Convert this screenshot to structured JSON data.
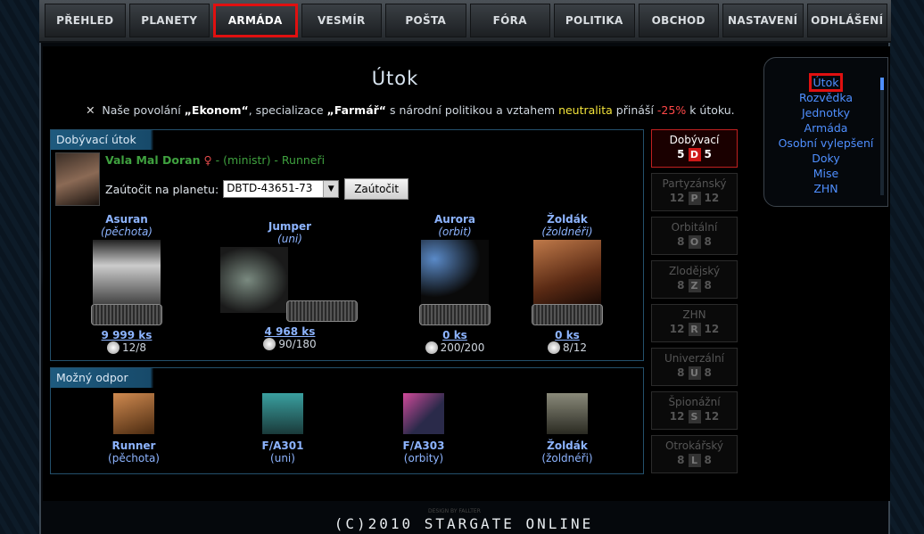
{
  "nav": [
    {
      "label": "PŘEHLED"
    },
    {
      "label": "PLANETY"
    },
    {
      "label": "ARMÁDA",
      "active": true
    },
    {
      "label": "VESMÍR"
    },
    {
      "label": "POŠTA"
    },
    {
      "label": "FÓRA"
    },
    {
      "label": "POLITIKA"
    },
    {
      "label": "OBCHOD"
    },
    {
      "label": "NASTAVENÍ"
    },
    {
      "label": "ODHLÁŠENÍ"
    }
  ],
  "page_title": "Útok",
  "info": {
    "prefix": "Naše povolání",
    "profession": "„Ekonom“",
    "mid1": ", specializace",
    "specialization": "„Farmář“",
    "mid2": "s národní politikou a vztahem",
    "relation": "neutralita",
    "mid3": "přináší",
    "bonus": "-25%",
    "suffix": "k útoku."
  },
  "attack_panel": {
    "title": "Dobývací útok",
    "player_name": "Vala Mal Doran",
    "gender_symbol": "♀",
    "player_meta": "- (ministr) - Runneři",
    "attack_label": "Zaútočit na planetu:",
    "planet_value": "DBTD-43651-73",
    "attack_button": "Zaútočit"
  },
  "units": [
    {
      "name": "Asuran",
      "type": "(pěchota)",
      "count": "9 999 ks",
      "stat": "12/8"
    },
    {
      "name": "Jumper",
      "type": "(uni)",
      "count": "4 968 ks",
      "stat": "90/180"
    },
    {
      "name": "Aurora",
      "type": "(orbit)",
      "count": "0 ks",
      "stat": "200/200"
    },
    {
      "name": "Žoldák",
      "type": "(žoldnéři)",
      "count": "0 ks",
      "stat": "8/12"
    }
  ],
  "defense_panel": {
    "title": "Možný odpor",
    "items": [
      {
        "name": "Runner",
        "type": "(pěchota)"
      },
      {
        "name": "F/A301",
        "type": "(uni)"
      },
      {
        "name": "F/A303",
        "type": "(orbity)"
      },
      {
        "name": "Žoldák",
        "type": "(žoldnéři)"
      }
    ]
  },
  "attack_types": [
    {
      "label": "Dobývací",
      "left": "5",
      "letter": "D",
      "right": "5",
      "active": true
    },
    {
      "label": "Partyzánský",
      "left": "12",
      "letter": "P",
      "right": "12"
    },
    {
      "label": "Orbitální",
      "left": "8",
      "letter": "O",
      "right": "8"
    },
    {
      "label": "Zlodějský",
      "left": "8",
      "letter": "Z",
      "right": "8"
    },
    {
      "label": "ZHN",
      "left": "12",
      "letter": "R",
      "right": "12"
    },
    {
      "label": "Univerzální",
      "left": "8",
      "letter": "U",
      "right": "8"
    },
    {
      "label": "Špionážní",
      "left": "12",
      "letter": "S",
      "right": "12"
    },
    {
      "label": "Otrokářský",
      "left": "8",
      "letter": "L",
      "right": "8"
    }
  ],
  "side_menu": [
    "Útok",
    "Rozvědka",
    "Jednotky",
    "Armáda",
    "Osobní vylepšení",
    "Doky",
    "Mise",
    "ZHN"
  ],
  "footer": "(C)2010 STARGATE ONLINE",
  "design_credit": "DESIGN BY FALLTER"
}
